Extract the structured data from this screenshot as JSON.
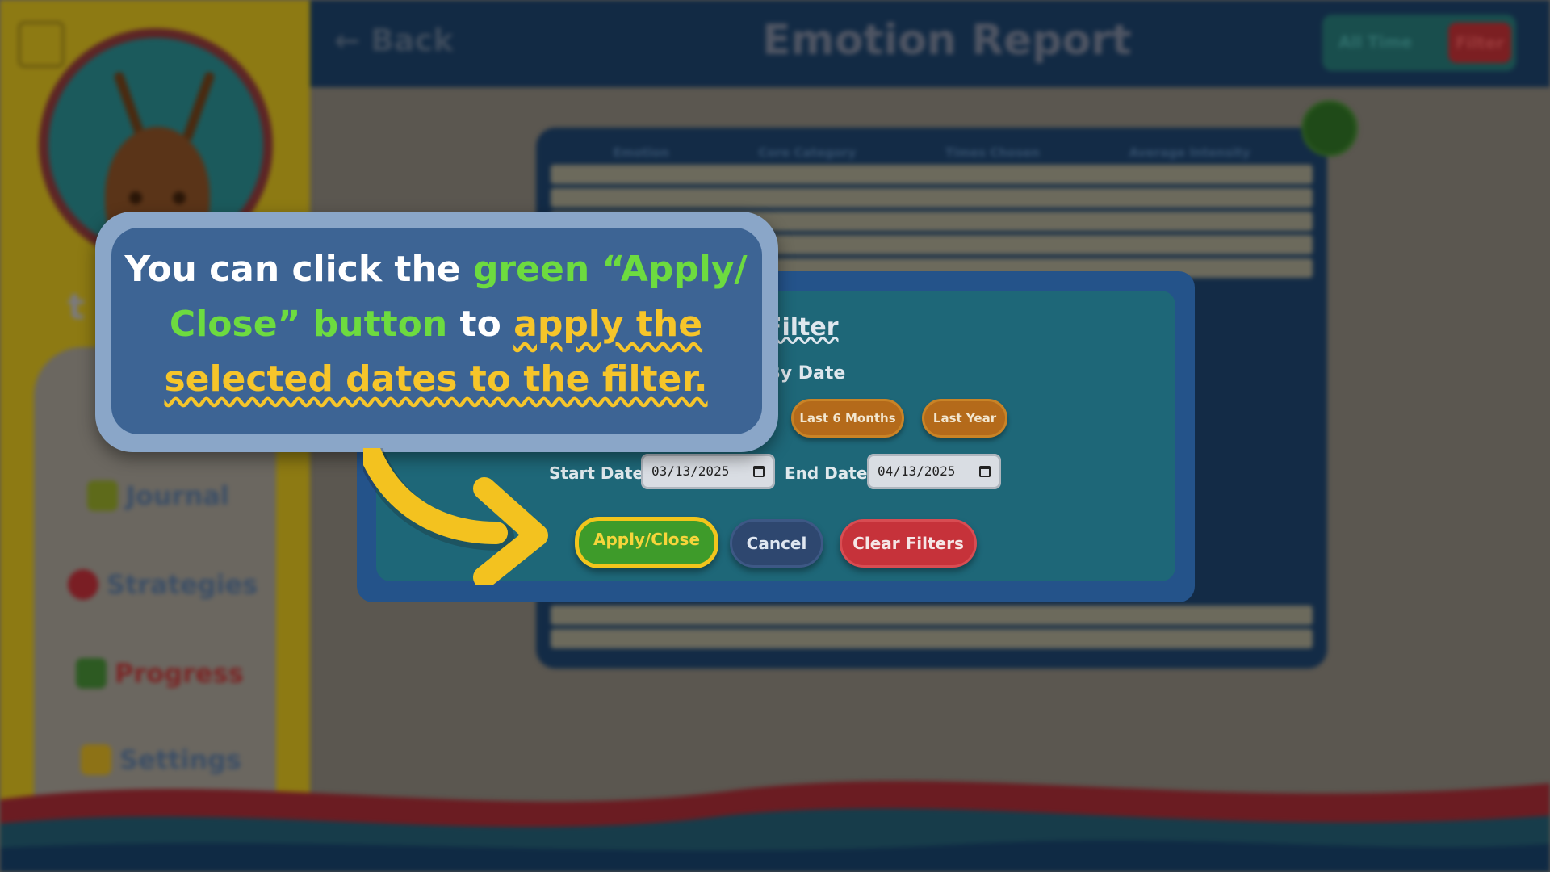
{
  "sidebar": {
    "brand_letter": "t",
    "items": [
      {
        "label": "Journal",
        "icon": "pencil-icon"
      },
      {
        "label": "Strategies",
        "icon": "heart-icon"
      },
      {
        "label": "Progress",
        "icon": "chart-icon"
      },
      {
        "label": "Settings",
        "icon": "gear-icon"
      }
    ]
  },
  "header": {
    "back_label": "Back",
    "title": "Emotion Report",
    "range_label": "All Time",
    "filter_label": "Filter"
  },
  "table": {
    "columns": [
      "Emotion",
      "Core Category",
      "Times Chosen",
      "Average Intensity"
    ]
  },
  "dialog": {
    "title": "Filter",
    "subtitle": "By Date",
    "presets": [
      "Last 6 Months",
      "Last Year"
    ],
    "start_label": "Start Date:",
    "start_value": "03/13/2025",
    "end_label": "End Date:",
    "end_value": "04/13/2025",
    "apply_label": "Apply/Close",
    "cancel_label": "Cancel",
    "clear_label": "Clear Filters"
  },
  "callout": {
    "part1": "You can click the ",
    "part2": "green “Apply/ Close” button",
    "part3": " to ",
    "part4": "apply the selected dates to the filter."
  },
  "colors": {
    "apply_green": "#3e9b2a",
    "highlight_yellow": "#f6c52a",
    "highlight_green": "#6ddb3f",
    "clear_red": "#c6323a"
  }
}
